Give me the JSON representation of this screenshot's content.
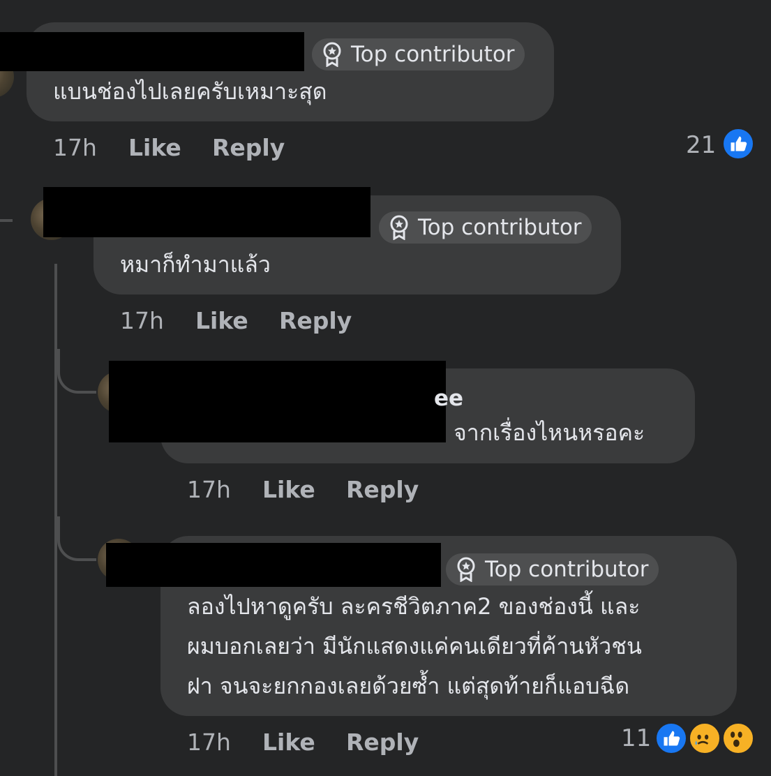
{
  "comments": [
    {
      "badge": "Top contributor",
      "text": "แบนช่องไปเลยครับเหมาะสุด",
      "time": "17h",
      "like": "Like",
      "reply": "Reply",
      "reaction_count": "21",
      "reactions": [
        "like-icon"
      ]
    },
    {
      "badge": "Top contributor",
      "text": "หมาก็ทำมาแล้ว",
      "time": "17h",
      "like": "Like",
      "reply": "Reply"
    },
    {
      "name_fragment": "ee",
      "text": "จากเรื่องไหนหรอคะ",
      "time": "17h",
      "like": "Like",
      "reply": "Reply"
    },
    {
      "badge": "Top contributor",
      "text_lines": [
        "ลองไปหาดูครับ ละครชีวิตภาค2 ของช่องนี้ และ",
        "ผมบอกเลยว่า มีนักแสดงแค่คนเดียวที่ค้านหัวชน",
        "ฝา จนจะยกกองเลยด้วยซ้ำ แต่สุดท้ายก็แอบฉีด"
      ],
      "time": "17h",
      "like": "Like",
      "reply": "Reply",
      "reaction_count": "11",
      "reactions": [
        "like-icon",
        "sad-icon",
        "wow-icon"
      ]
    }
  ],
  "colors": {
    "background": "#242526",
    "bubble": "#3a3b3c",
    "badge": "#4e4f50",
    "text": "#e4e6eb",
    "meta": "#b0b3b8",
    "like_blue": "#1877f2"
  }
}
